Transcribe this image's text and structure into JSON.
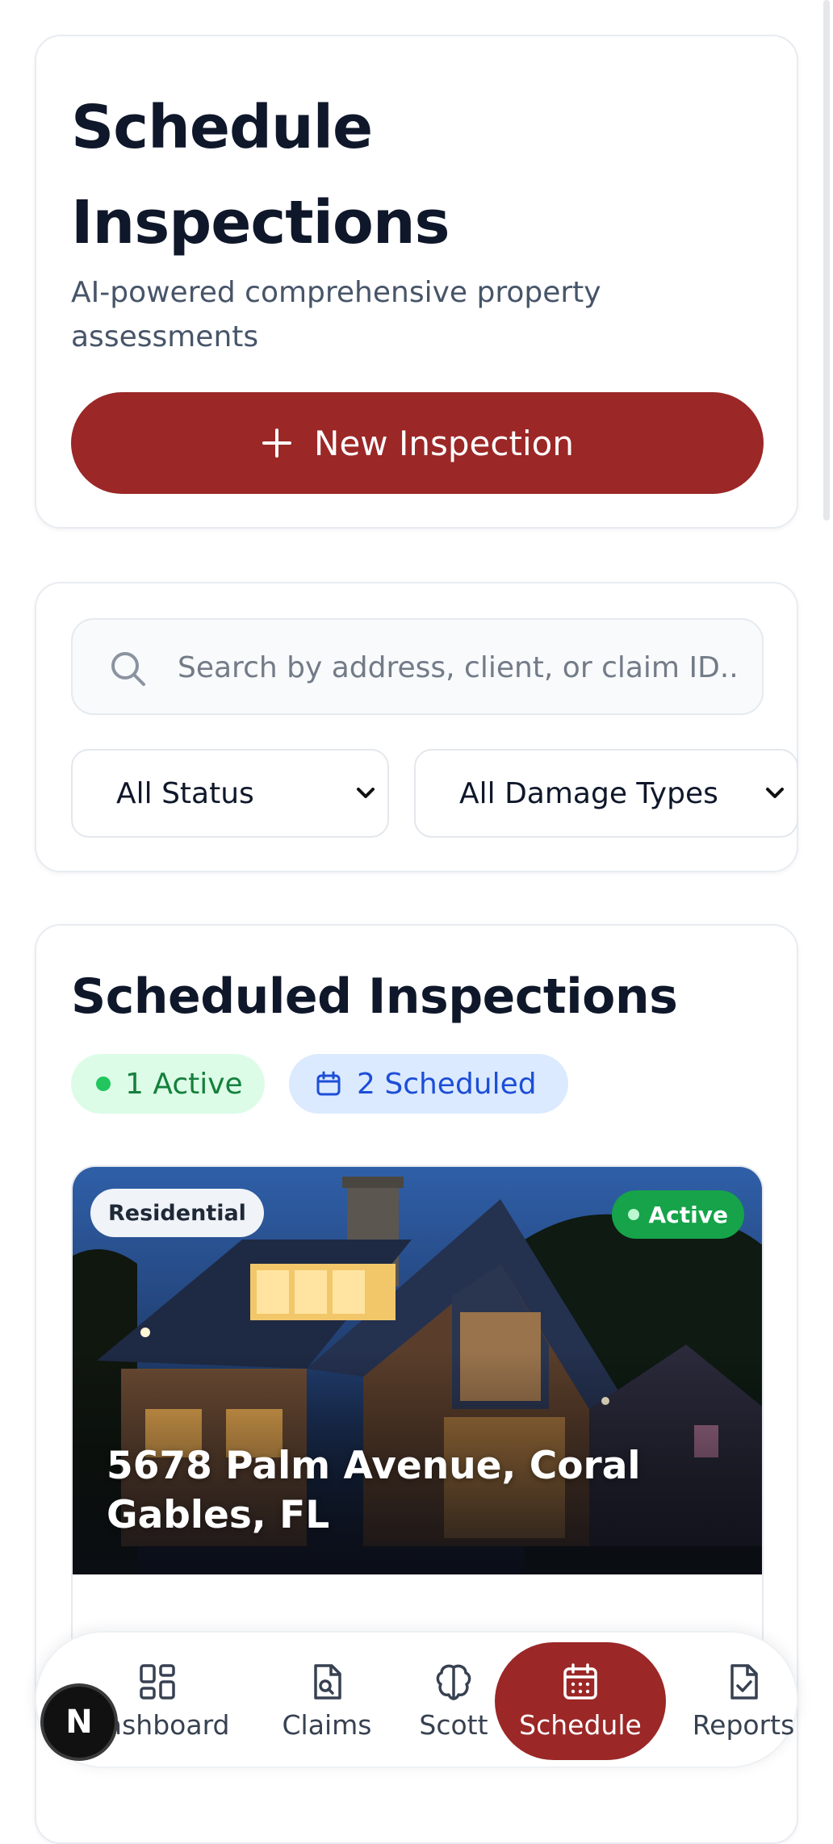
{
  "header": {
    "title": "Schedule Inspections",
    "subtitle": "AI-powered comprehensive property assessments",
    "new_button_label": "New Inspection"
  },
  "filters": {
    "search_placeholder": "Search by address, client, or claim ID..",
    "status_select": "All Status",
    "damage_select": "All Damage Types"
  },
  "scheduled": {
    "title": "Scheduled Inspections",
    "active_chip": "1 Active",
    "scheduled_chip": "2 Scheduled",
    "items": [
      {
        "type_tag": "Residential",
        "status": "Active",
        "address": "5678 Palm Avenue, Coral Gables, FL"
      }
    ]
  },
  "nav": {
    "items": [
      {
        "label": "Dashboard",
        "icon": "grid-icon"
      },
      {
        "label": "Claims",
        "icon": "file-search-icon"
      },
      {
        "label": "Scott",
        "icon": "brain-icon"
      },
      {
        "label": "Schedule",
        "icon": "calendar-icon"
      },
      {
        "label": "Reports",
        "icon": "file-check-icon"
      }
    ],
    "visible_dashboard_label": "hboard",
    "active": "Schedule"
  },
  "badge": {
    "letter": "N"
  },
  "colors": {
    "primary": "#9b2727",
    "active_green": "#16a34a",
    "scheduled_blue": "#1d4ed8"
  }
}
